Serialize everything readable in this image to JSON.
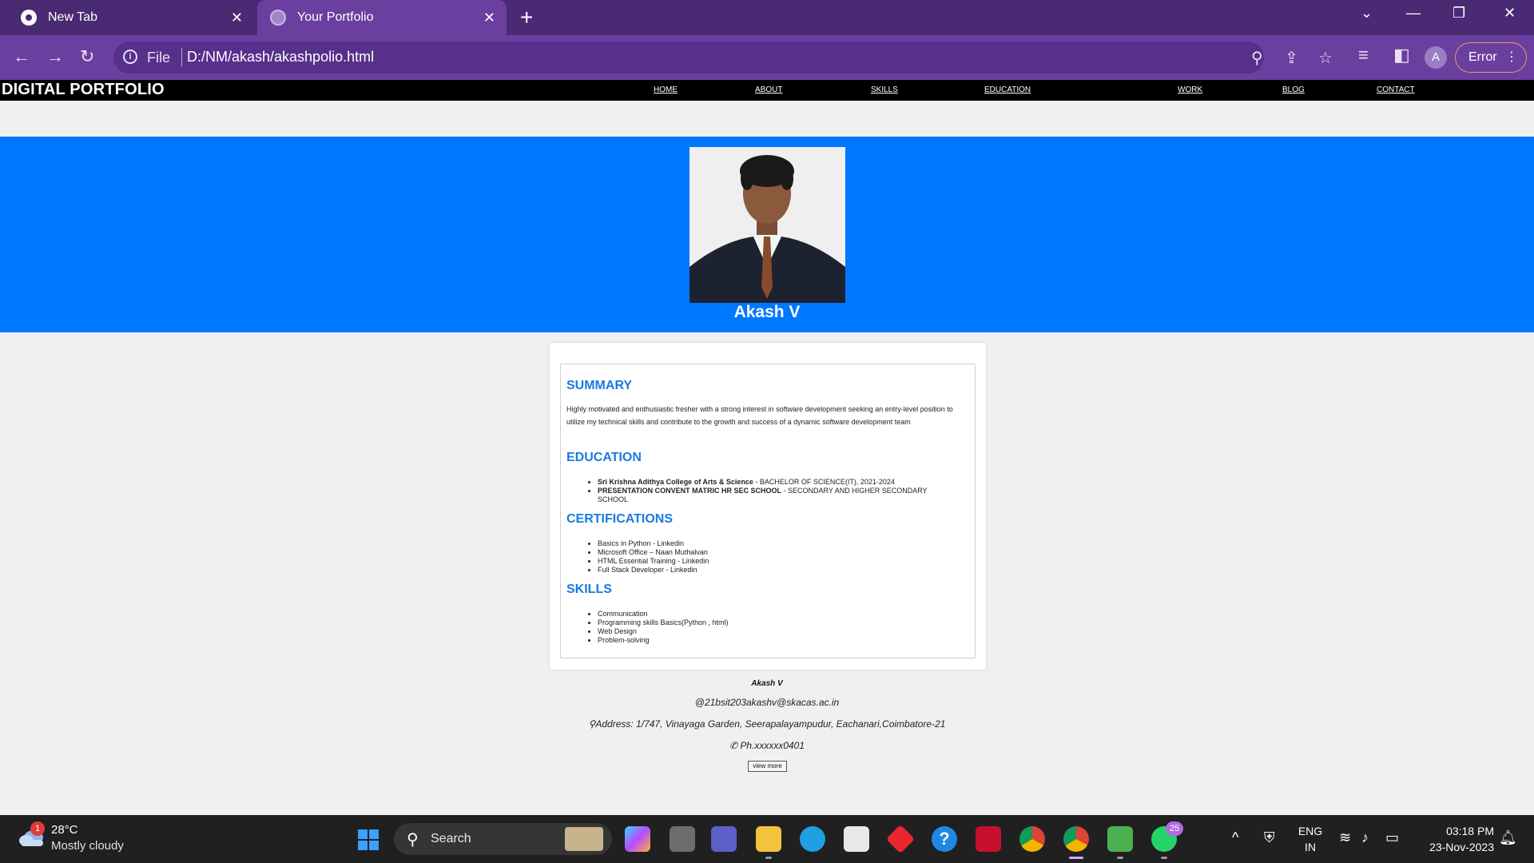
{
  "browser": {
    "tabs": [
      {
        "title": "New Tab",
        "close": "✕"
      },
      {
        "title": "Your Portfolio",
        "close": "✕"
      }
    ],
    "new_tab": "+",
    "window_controls": [
      "⌄",
      "—",
      "❐",
      "✕"
    ],
    "nav": {
      "back": "←",
      "forward": "→",
      "reload": "↻"
    },
    "address": {
      "scheme": "File",
      "url": "D:/NM/akash/akashpolio.html"
    },
    "profile_initial": "A",
    "error_label": "Error"
  },
  "page": {
    "brand": "DIGITAL PORTFOLIO",
    "nav": [
      "HOME",
      "ABOUT",
      "SKILLS",
      "EDUCATION",
      "WORK",
      "BLOG",
      "CONTACT"
    ],
    "hero_name": "Akash V",
    "summary": {
      "title": "SUMMARY",
      "text": "Highly motivated and enthusiastic fresher with a strong interest in software development seeking an entry-level position to utilize my technical skills and contribute to the growth and success of a dynamic software development team"
    },
    "education": {
      "title": "EDUCATION",
      "items": [
        {
          "school": "Sri Krishna Adithya College of Arts & Science",
          "detail": " - BACHELOR OF SCIENCE(IT), 2021-2024"
        },
        {
          "school": "PRESENTATION CONVENT MATRIC HR SEC SCHOOL",
          "detail": " - SECONDARY AND HIGHER SECONDARY SCHOOL"
        }
      ]
    },
    "certifications": {
      "title": "CERTIFICATIONS",
      "items": [
        "Basics in Python - Linkedin",
        "Microsoft Office – Naan Muthalvan",
        "HTML Essential Training - Linkedin",
        "Full Stack Developer - Linkedin"
      ]
    },
    "skills": {
      "title": "SKILLS",
      "items": [
        "Communication",
        "Programming skills Basics(Python , html)",
        "Web Design",
        "Problem-solving"
      ]
    },
    "footer": {
      "name": "Akash V",
      "email": "@21bsit203akashv@skacas.ac.in",
      "address": "⚲Address: 1/747, Vinayaga Garden, Seerapalayampudur, Eachanari,Coimbatore-21",
      "phone": "✆ Ph.xxxxxx0401",
      "view_more": "view more"
    }
  },
  "taskbar": {
    "weather": {
      "badge": "1",
      "temp": "28°C",
      "desc": "Mostly cloudy"
    },
    "search_label": "Search",
    "whatsapp_badge": "25",
    "tray": {
      "lang": "ENG",
      "region": "IN",
      "time": "03:18 PM",
      "date": "23-Nov-2023"
    }
  },
  "colors": {
    "hero": "#0077ff",
    "section_title": "#1a7ae0",
    "browser_frame": "#6b3fa0"
  }
}
